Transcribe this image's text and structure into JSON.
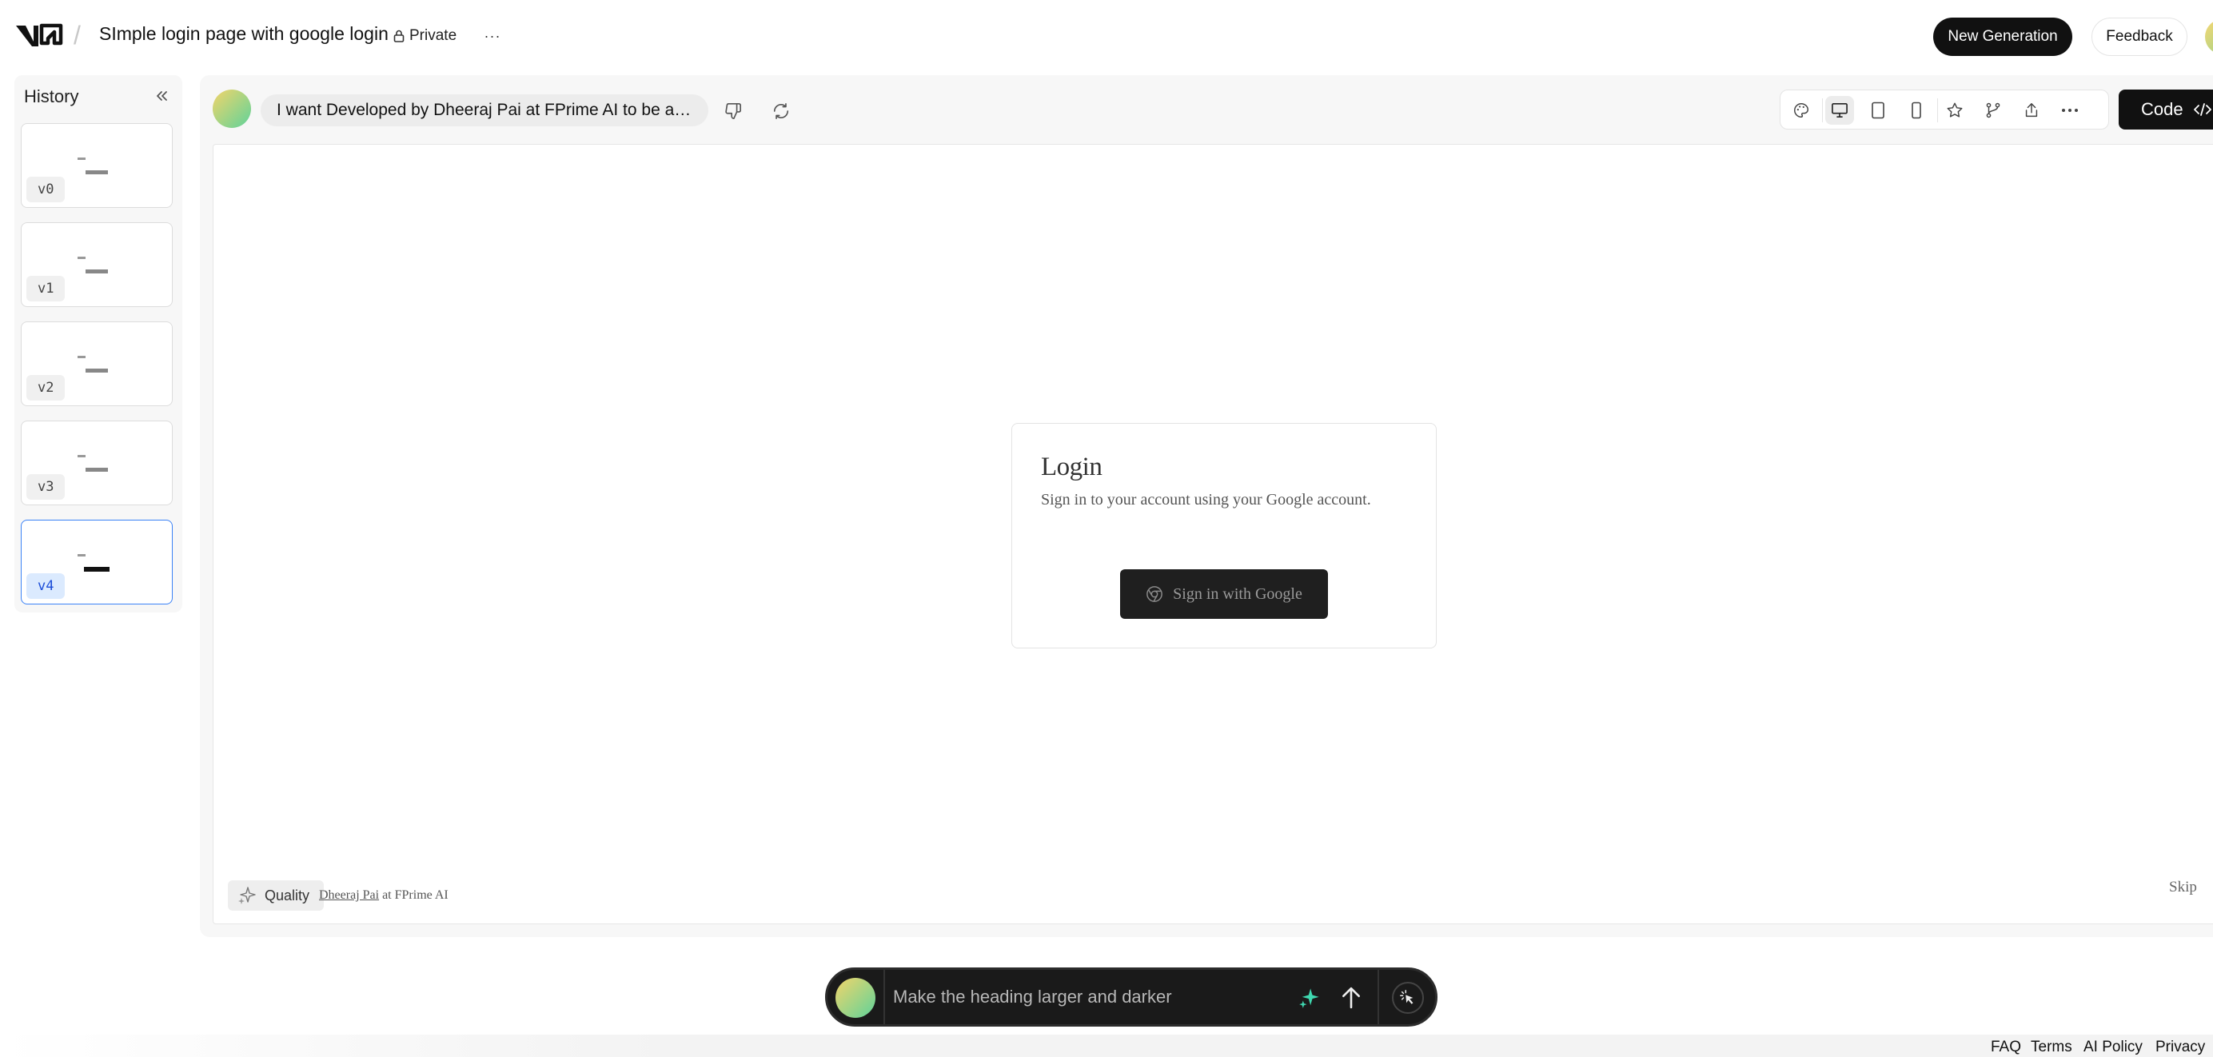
{
  "header": {
    "project_title": "SImple login page with google login",
    "visibility": "Private",
    "more": "···",
    "new_generation": "New Generation",
    "feedback": "Feedback"
  },
  "sidebar": {
    "title": "History",
    "versions": [
      {
        "label": "v0",
        "active": false
      },
      {
        "label": "v1",
        "active": false
      },
      {
        "label": "v2",
        "active": false
      },
      {
        "label": "v3",
        "active": false
      },
      {
        "label": "v4",
        "active": true
      }
    ]
  },
  "generation": {
    "prompt": "I want Developed by Dheeraj Pai at FPrime AI to be a…"
  },
  "toolbar": {
    "icons": [
      "palette-icon",
      "desktop-icon",
      "tablet-icon",
      "mobile-icon",
      "star-icon",
      "fork-icon",
      "share-icon",
      "more-icon"
    ],
    "selected_view": "desktop",
    "code_label": "Code"
  },
  "preview": {
    "heading": "Login",
    "subtitle": "Sign in to your account using your Google account.",
    "google_button": "Sign in with Google",
    "quality_label": "Quality",
    "credit_name": "Dheeraj Pai",
    "credit_rest": " at FPrime AI",
    "skip": "Skip"
  },
  "promptbar": {
    "placeholder": "Make the heading larger and darker"
  },
  "footer": {
    "links": [
      "FAQ",
      "Terms",
      "AI Policy",
      "Privacy"
    ]
  },
  "colors": {
    "accent": "#111111",
    "active_version": "#3b82f6",
    "background": "#f7f7f7"
  }
}
